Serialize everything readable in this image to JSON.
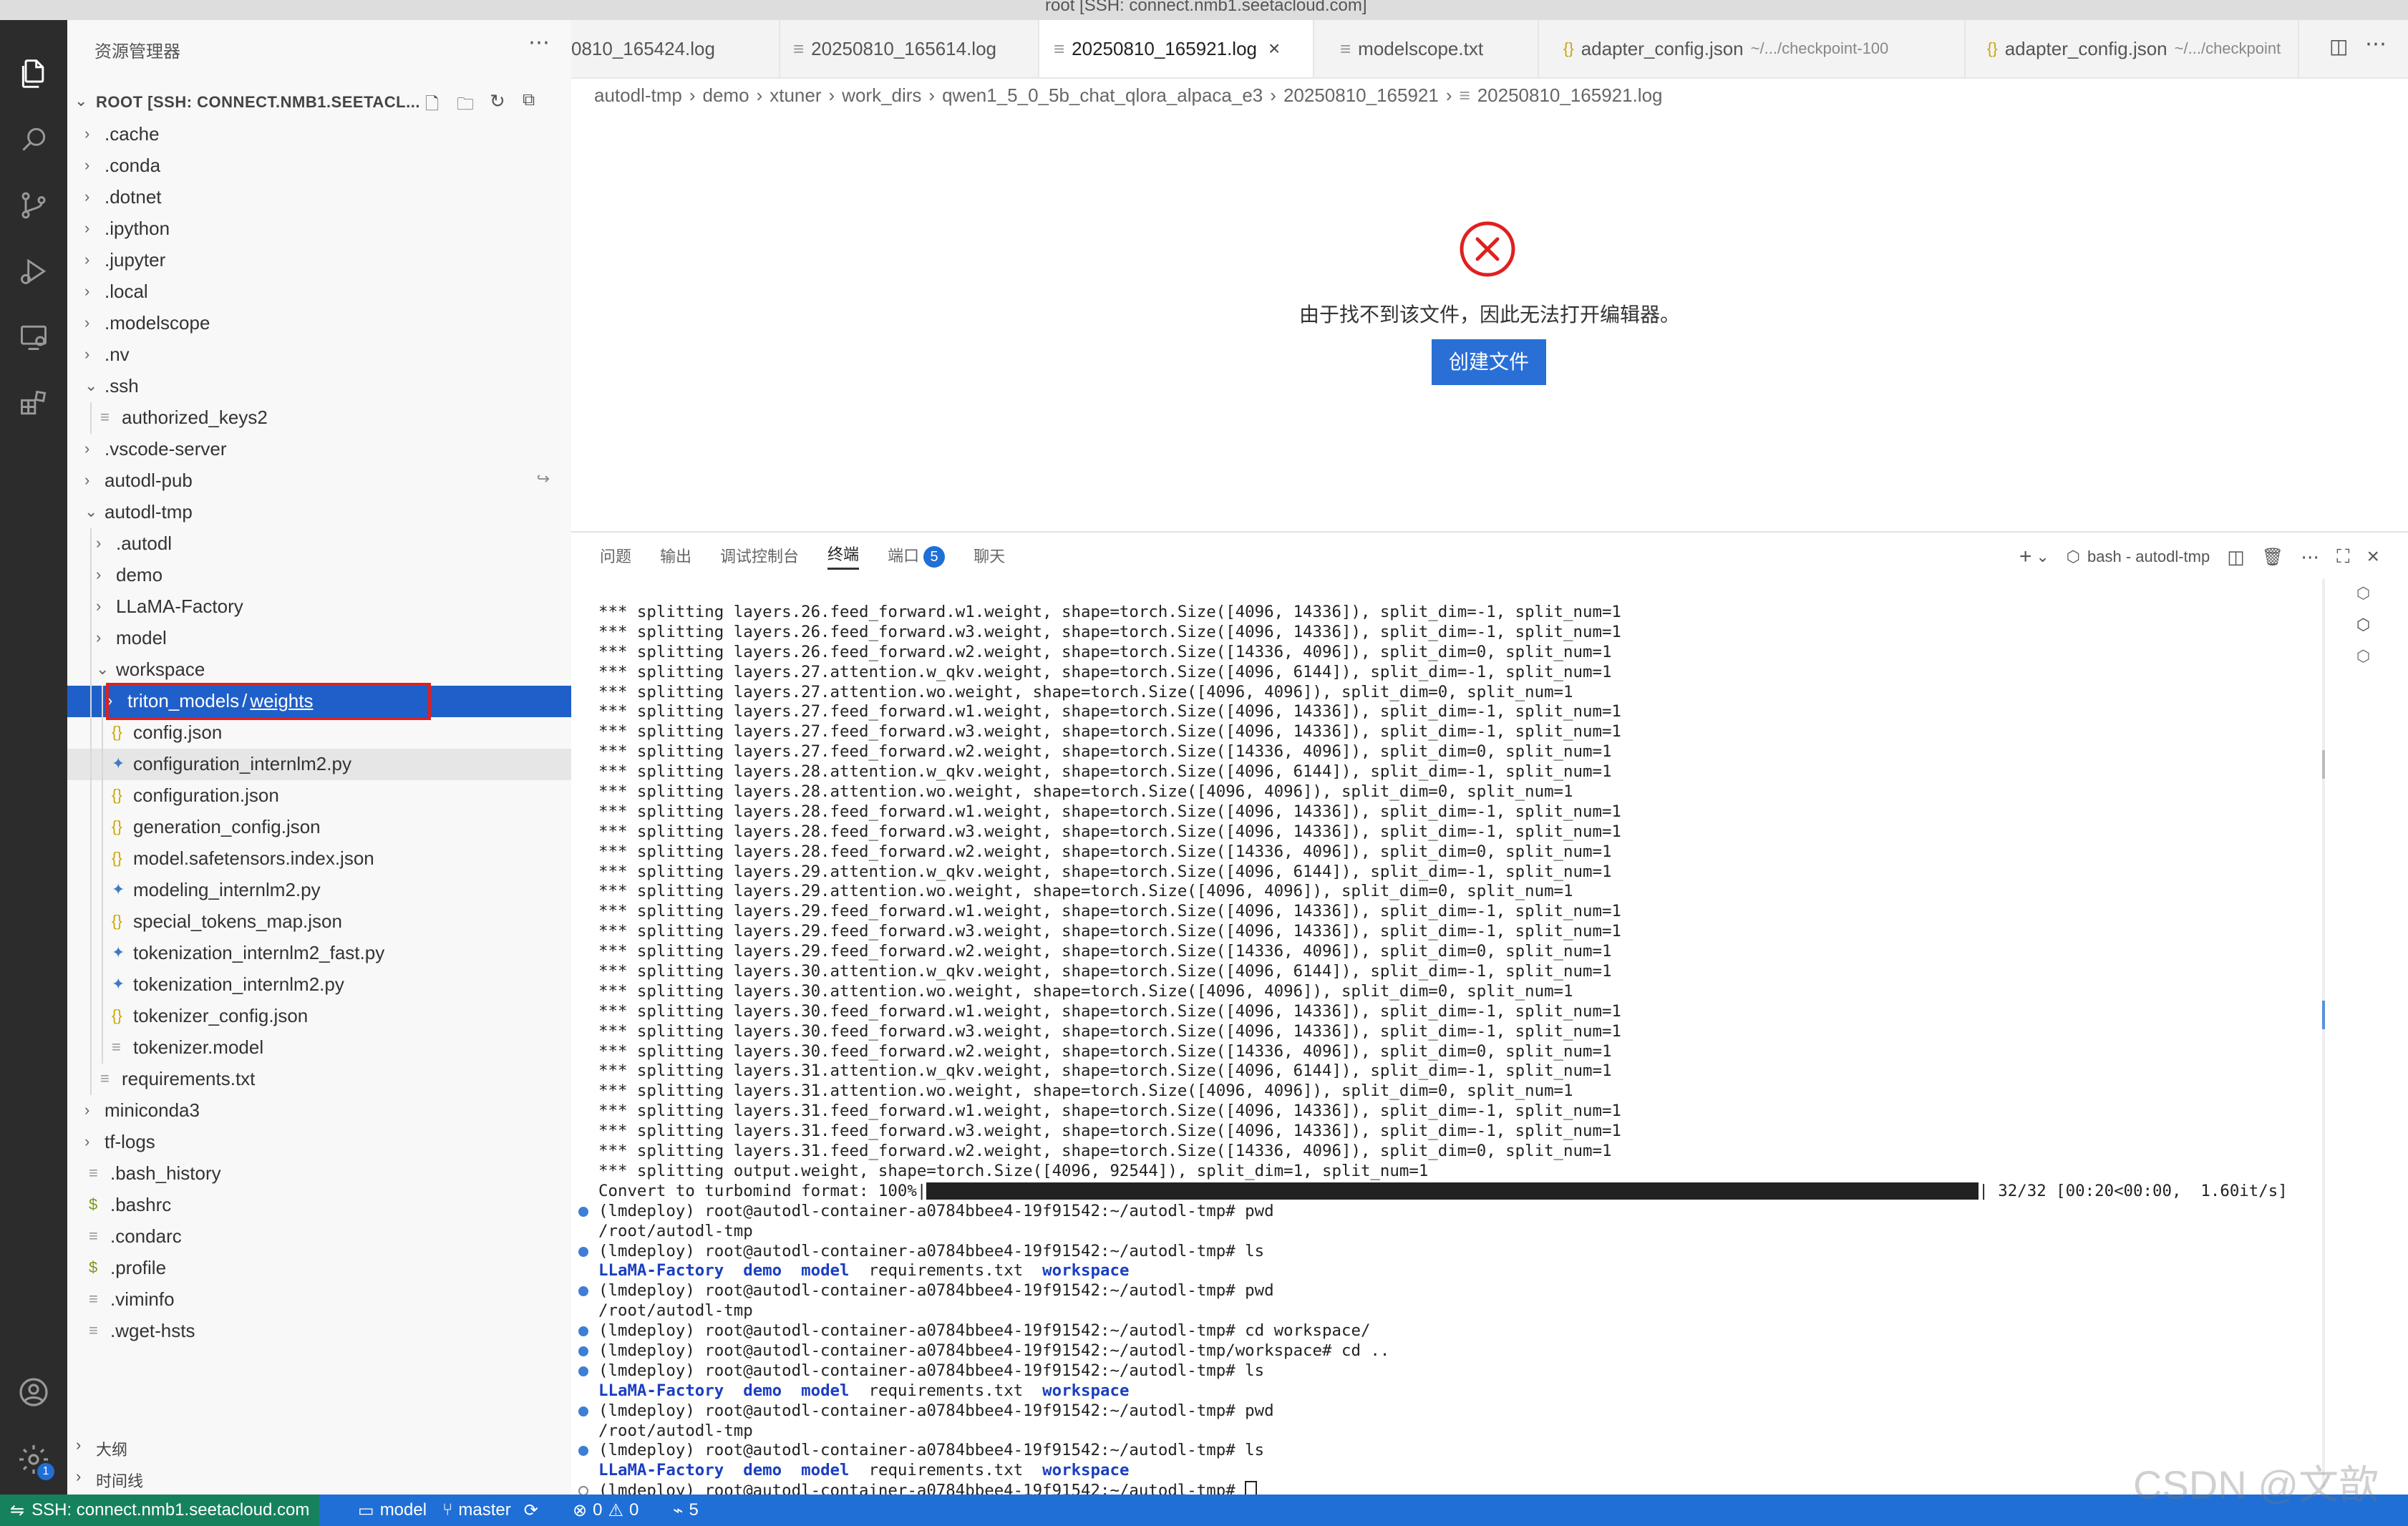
{
  "window": {
    "title": "root [SSH: connect.nmb1.seetacloud.com]"
  },
  "colors": {
    "accent": "#1f6fd6",
    "selection": "#1f5fc9",
    "remote": "#16825d",
    "error": "#e02020",
    "terminal_dir": "#1a3fbf"
  },
  "activity_bar": {
    "icons": [
      "files-icon",
      "search-icon",
      "source-control-icon",
      "run-debug-icon",
      "remote-explorer-icon",
      "extensions-icon",
      "account-icon",
      "settings-gear-icon"
    ],
    "settings_badge": "1"
  },
  "sidebar": {
    "title": "资源管理器",
    "root_label": "ROOT [SSH: CONNECT.NMB1.SEETACL...",
    "tree": [
      {
        "label": ".cache",
        "kind": "folder",
        "open": false,
        "depth": 0
      },
      {
        "label": ".conda",
        "kind": "folder",
        "open": false,
        "depth": 0
      },
      {
        "label": ".dotnet",
        "kind": "folder",
        "open": false,
        "depth": 0
      },
      {
        "label": ".ipython",
        "kind": "folder",
        "open": false,
        "depth": 0
      },
      {
        "label": ".jupyter",
        "kind": "folder",
        "open": false,
        "depth": 0
      },
      {
        "label": ".local",
        "kind": "folder",
        "open": false,
        "depth": 0
      },
      {
        "label": ".modelscope",
        "kind": "folder",
        "open": false,
        "depth": 0
      },
      {
        "label": ".nv",
        "kind": "folder",
        "open": false,
        "depth": 0
      },
      {
        "label": ".ssh",
        "kind": "folder",
        "open": true,
        "depth": 0
      },
      {
        "label": "authorized_keys2",
        "kind": "file-text",
        "depth": 1
      },
      {
        "label": ".vscode-server",
        "kind": "folder",
        "open": false,
        "depth": 0
      },
      {
        "label": "autodl-pub",
        "kind": "folder-link",
        "open": false,
        "depth": 0
      },
      {
        "label": "autodl-tmp",
        "kind": "folder",
        "open": true,
        "depth": 0
      },
      {
        "label": ".autodl",
        "kind": "folder",
        "open": false,
        "depth": 1
      },
      {
        "label": "demo",
        "kind": "folder",
        "open": false,
        "depth": 1
      },
      {
        "label": "LLaMA-Factory",
        "kind": "folder",
        "open": false,
        "depth": 1
      },
      {
        "label": "model",
        "kind": "folder",
        "open": false,
        "depth": 1
      },
      {
        "label": "workspace",
        "kind": "folder",
        "open": true,
        "depth": 1
      },
      {
        "label": "triton_models / weights",
        "kind": "folder-selected",
        "open": false,
        "depth": 2
      },
      {
        "label": "config.json",
        "kind": "file-json",
        "depth": 2
      },
      {
        "label": "configuration_internlm2.py",
        "kind": "file-py",
        "depth": 2
      },
      {
        "label": "configuration.json",
        "kind": "file-json",
        "depth": 2
      },
      {
        "label": "generation_config.json",
        "kind": "file-json",
        "depth": 2
      },
      {
        "label": "model.safetensors.index.json",
        "kind": "file-json",
        "depth": 2
      },
      {
        "label": "modeling_internlm2.py",
        "kind": "file-py",
        "depth": 2
      },
      {
        "label": "special_tokens_map.json",
        "kind": "file-json",
        "depth": 2
      },
      {
        "label": "tokenization_internlm2_fast.py",
        "kind": "file-py",
        "depth": 2
      },
      {
        "label": "tokenization_internlm2.py",
        "kind": "file-py",
        "depth": 2
      },
      {
        "label": "tokenizer_config.json",
        "kind": "file-json",
        "depth": 2
      },
      {
        "label": "tokenizer.model",
        "kind": "file-text",
        "depth": 2
      },
      {
        "label": "requirements.txt",
        "kind": "file-text",
        "depth": 1
      },
      {
        "label": "miniconda3",
        "kind": "folder",
        "open": false,
        "depth": 0
      },
      {
        "label": "tf-logs",
        "kind": "folder",
        "open": false,
        "depth": 0
      },
      {
        "label": ".bash_history",
        "kind": "file-text",
        "depth": 0
      },
      {
        "label": ".bashrc",
        "kind": "file-shell",
        "depth": 0
      },
      {
        "label": ".condarc",
        "kind": "file-text",
        "depth": 0
      },
      {
        "label": ".profile",
        "kind": "file-shell",
        "depth": 0
      },
      {
        "label": ".viminfo",
        "kind": "file-text",
        "depth": 0
      },
      {
        "label": ".wget-hsts",
        "kind": "file-text",
        "depth": 0
      }
    ],
    "outline": "大纲",
    "timeline": "时间线"
  },
  "tabs": [
    {
      "label": "0810_165424.log",
      "icon": "none"
    },
    {
      "label": "20250810_165614.log",
      "icon": "file-text-icon"
    },
    {
      "label": "20250810_165921.log",
      "icon": "file-text-icon",
      "active": true
    },
    {
      "label": "modelscope.txt",
      "icon": "file-text-icon"
    },
    {
      "label": "adapter_config.json",
      "hint": "~/.../checkpoint-100",
      "icon": "json-icon"
    },
    {
      "label": "adapter_config.json",
      "hint": "~/.../checkpoint",
      "icon": "json-icon"
    }
  ],
  "breadcrumb": [
    "autodl-tmp",
    "demo",
    "xtuner",
    "work_dirs",
    "qwen1_5_0_5b_chat_qlora_alpaca_e3",
    "20250810_165921",
    "20250810_165921.log"
  ],
  "editor_error": {
    "message": "由于找不到该文件，因此无法打开编辑器。",
    "button": "创建文件"
  },
  "panel": {
    "tabs": [
      "问题",
      "输出",
      "调试控制台",
      "终端",
      "端口",
      "聊天"
    ],
    "active_tab": "终端",
    "ports_badge": "5",
    "terminal_name": "bash - autodl-tmp",
    "progress": {
      "prefix": "Convert to turbomind format: 100%|",
      "fraction": 1.0,
      "suffix": "| 32/32 [00:20<00:00,  1.60it/s]"
    },
    "terminal_lines": [
      "*** splitting layers.26.feed_forward.w1.weight, shape=torch.Size([4096, 14336]), split_dim=-1, split_num=1",
      "*** splitting layers.26.feed_forward.w3.weight, shape=torch.Size([4096, 14336]), split_dim=-1, split_num=1",
      "*** splitting layers.26.feed_forward.w2.weight, shape=torch.Size([14336, 4096]), split_dim=0, split_num=1",
      "*** splitting layers.27.attention.w_qkv.weight, shape=torch.Size([4096, 6144]), split_dim=-1, split_num=1",
      "*** splitting layers.27.attention.wo.weight, shape=torch.Size([4096, 4096]), split_dim=0, split_num=1",
      "*** splitting layers.27.feed_forward.w1.weight, shape=torch.Size([4096, 14336]), split_dim=-1, split_num=1",
      "*** splitting layers.27.feed_forward.w3.weight, shape=torch.Size([4096, 14336]), split_dim=-1, split_num=1",
      "*** splitting layers.27.feed_forward.w2.weight, shape=torch.Size([14336, 4096]), split_dim=0, split_num=1",
      "*** splitting layers.28.attention.w_qkv.weight, shape=torch.Size([4096, 6144]), split_dim=-1, split_num=1",
      "*** splitting layers.28.attention.wo.weight, shape=torch.Size([4096, 4096]), split_dim=0, split_num=1",
      "*** splitting layers.28.feed_forward.w1.weight, shape=torch.Size([4096, 14336]), split_dim=-1, split_num=1",
      "*** splitting layers.28.feed_forward.w3.weight, shape=torch.Size([4096, 14336]), split_dim=-1, split_num=1",
      "*** splitting layers.28.feed_forward.w2.weight, shape=torch.Size([14336, 4096]), split_dim=0, split_num=1",
      "*** splitting layers.29.attention.w_qkv.weight, shape=torch.Size([4096, 6144]), split_dim=-1, split_num=1",
      "*** splitting layers.29.attention.wo.weight, shape=torch.Size([4096, 4096]), split_dim=0, split_num=1",
      "*** splitting layers.29.feed_forward.w1.weight, shape=torch.Size([4096, 14336]), split_dim=-1, split_num=1",
      "*** splitting layers.29.feed_forward.w3.weight, shape=torch.Size([4096, 14336]), split_dim=-1, split_num=1",
      "*** splitting layers.29.feed_forward.w2.weight, shape=torch.Size([14336, 4096]), split_dim=0, split_num=1",
      "*** splitting layers.30.attention.w_qkv.weight, shape=torch.Size([4096, 6144]), split_dim=-1, split_num=1",
      "*** splitting layers.30.attention.wo.weight, shape=torch.Size([4096, 4096]), split_dim=0, split_num=1",
      "*** splitting layers.30.feed_forward.w1.weight, shape=torch.Size([4096, 14336]), split_dim=-1, split_num=1",
      "*** splitting layers.30.feed_forward.w3.weight, shape=torch.Size([4096, 14336]), split_dim=-1, split_num=1",
      "*** splitting layers.30.feed_forward.w2.weight, shape=torch.Size([14336, 4096]), split_dim=0, split_num=1",
      "*** splitting layers.31.attention.w_qkv.weight, shape=torch.Size([4096, 6144]), split_dim=-1, split_num=1",
      "*** splitting layers.31.attention.wo.weight, shape=torch.Size([4096, 4096]), split_dim=0, split_num=1",
      "*** splitting layers.31.feed_forward.w1.weight, shape=torch.Size([4096, 14336]), split_dim=-1, split_num=1",
      "*** splitting layers.31.feed_forward.w3.weight, shape=torch.Size([4096, 14336]), split_dim=-1, split_num=1",
      "*** splitting layers.31.feed_forward.w2.weight, shape=torch.Size([14336, 4096]), split_dim=0, split_num=1",
      "*** splitting output.weight, shape=torch.Size([4096, 92544]), split_dim=1, split_num=1"
    ],
    "shell_lines": [
      {
        "dot": "filled",
        "text": "(lmdeploy) root@autodl-container-a0784bbee4-19f91542:~/autodl-tmp# pwd"
      },
      {
        "dot": "none",
        "text": "/root/autodl-tmp"
      },
      {
        "dot": "filled",
        "text": "(lmdeploy) root@autodl-container-a0784bbee4-19f91542:~/autodl-tmp# ls"
      },
      {
        "dot": "none",
        "ls": [
          "LLaMA-Factory",
          "demo",
          "model",
          "requirements.txt",
          "workspace"
        ]
      },
      {
        "dot": "filled",
        "text": "(lmdeploy) root@autodl-container-a0784bbee4-19f91542:~/autodl-tmp# pwd"
      },
      {
        "dot": "none",
        "text": "/root/autodl-tmp"
      },
      {
        "dot": "filled",
        "text": "(lmdeploy) root@autodl-container-a0784bbee4-19f91542:~/autodl-tmp# cd workspace/"
      },
      {
        "dot": "filled",
        "text": "(lmdeploy) root@autodl-container-a0784bbee4-19f91542:~/autodl-tmp/workspace# cd .."
      },
      {
        "dot": "filled",
        "text": "(lmdeploy) root@autodl-container-a0784bbee4-19f91542:~/autodl-tmp# ls"
      },
      {
        "dot": "none",
        "ls": [
          "LLaMA-Factory",
          "demo",
          "model",
          "requirements.txt",
          "workspace"
        ]
      },
      {
        "dot": "filled",
        "text": "(lmdeploy) root@autodl-container-a0784bbee4-19f91542:~/autodl-tmp# pwd"
      },
      {
        "dot": "none",
        "text": "/root/autodl-tmp"
      },
      {
        "dot": "filled",
        "text": "(lmdeploy) root@autodl-container-a0784bbee4-19f91542:~/autodl-tmp# ls"
      },
      {
        "dot": "none",
        "ls": [
          "LLaMA-Factory",
          "demo",
          "model",
          "requirements.txt",
          "workspace"
        ]
      },
      {
        "dot": "hollow",
        "text": "(lmdeploy) root@autodl-container-a0784bbee4-19f91542:~/autodl-tmp# ",
        "cursor": true
      }
    ]
  },
  "statusbar": {
    "remote": "SSH: connect.nmb1.seetacloud.com",
    "workspace": "model",
    "branch": "master",
    "errors": "0",
    "warnings": "0",
    "ports": "5"
  },
  "watermark": "CSDN @文歆"
}
